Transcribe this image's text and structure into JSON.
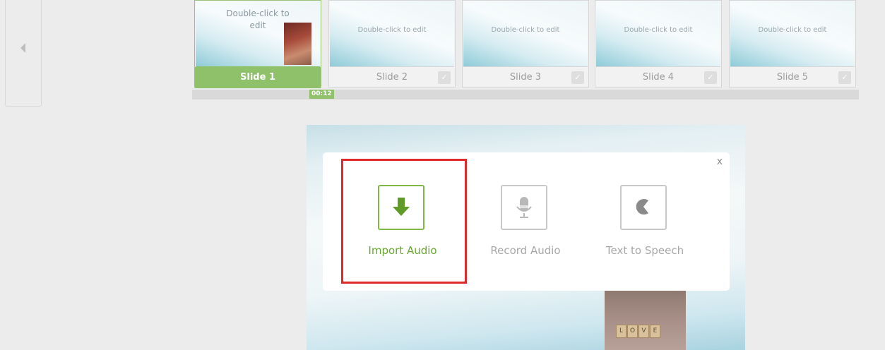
{
  "filmstrip": {
    "slides": [
      {
        "label": "Slide 1",
        "thumb_text": "Double-click to edit",
        "active": true
      },
      {
        "label": "Slide 2",
        "thumb_text": "Double-click to edit",
        "active": false
      },
      {
        "label": "Slide 3",
        "thumb_text": "Double-click to edit",
        "active": false
      },
      {
        "label": "Slide 4",
        "thumb_text": "Double-click to edit",
        "active": false
      },
      {
        "label": "Slide 5",
        "thumb_text": "Double-click to edit",
        "active": false
      }
    ],
    "timeline_time": "00:12"
  },
  "audio_dialog": {
    "close_label": "x",
    "options": [
      {
        "label": "Import Audio",
        "icon": "download-arrow-icon",
        "highlighted": true
      },
      {
        "label": "Record Audio",
        "icon": "microphone-icon",
        "highlighted": false
      },
      {
        "label": "Text to Speech",
        "icon": "speaking-head-icon",
        "highlighted": false
      }
    ]
  },
  "canvas": {
    "photo_tiles": [
      "L",
      "O",
      "V",
      "E"
    ]
  },
  "colors": {
    "accent_green": "#8fc06a",
    "highlight_red": "#e02a2a",
    "dialog_bg": "#ffffff"
  }
}
